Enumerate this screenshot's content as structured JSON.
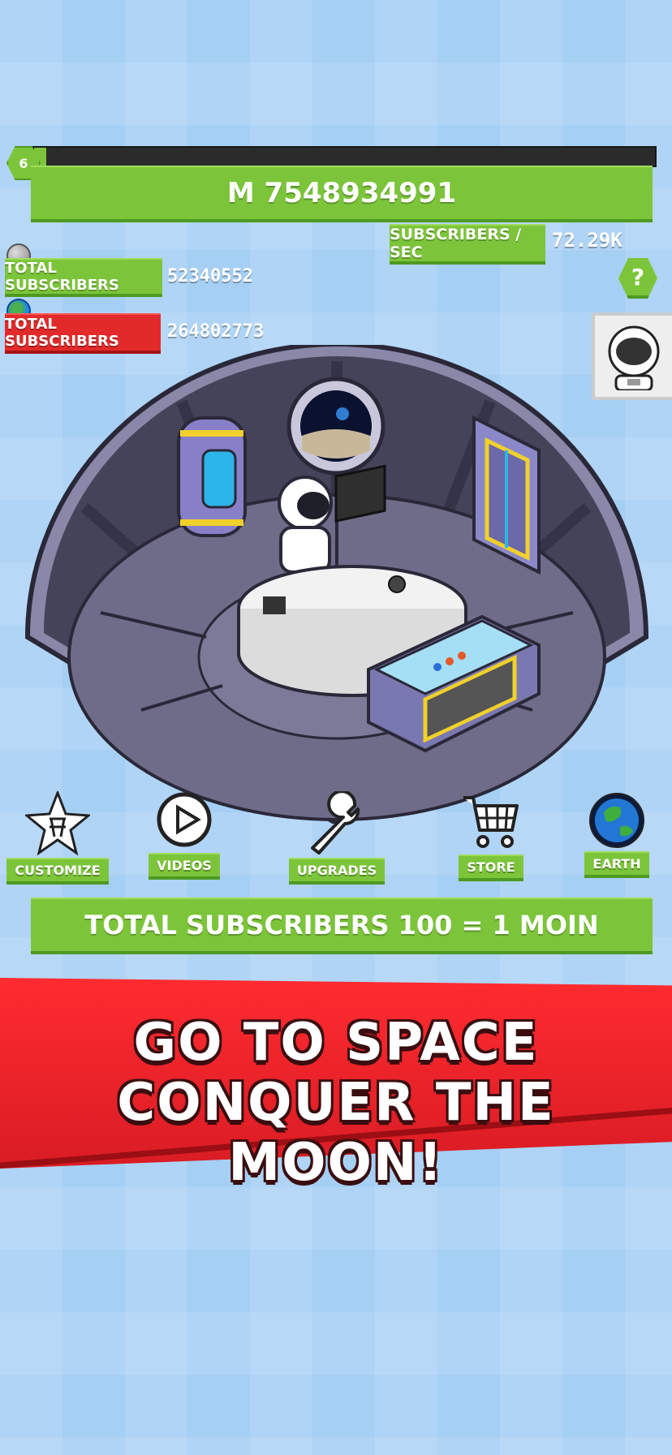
{
  "level": "6",
  "level_progress": 0.02,
  "currency": "M 7548934991",
  "subs_per_sec": {
    "label": "SUBSCRIBERS / SEC",
    "value": "72.29K"
  },
  "moon_stat": {
    "label": "TOTAL SUBSCRIBERS",
    "value": "52340552"
  },
  "earth_stat": {
    "label": "TOTAL SUBSCRIBERS",
    "value": "264802773"
  },
  "help_label": "?",
  "menu": {
    "customize": "CUSTOMIZE",
    "videos": "VIDEOS",
    "upgrades": "UPGRADES",
    "store": "STORE",
    "earth": "EARTH"
  },
  "conversion": "TOTAL SUBSCRIBERS 100 = 1 MOIN",
  "banner": {
    "line1": "GO TO SPACE",
    "line2": "CONQUER THE MOON!"
  },
  "colors": {
    "green": "#7cc53a",
    "red": "#e32a2a",
    "background": "#a6cff4",
    "progress_track": "#2a2a2a"
  },
  "icons": [
    "moon-icon",
    "earth-icon",
    "help-icon",
    "astronaut-avatar-icon",
    "star-chair-icon",
    "play-icon",
    "wrench-icon",
    "cart-icon",
    "earth-icon"
  ]
}
